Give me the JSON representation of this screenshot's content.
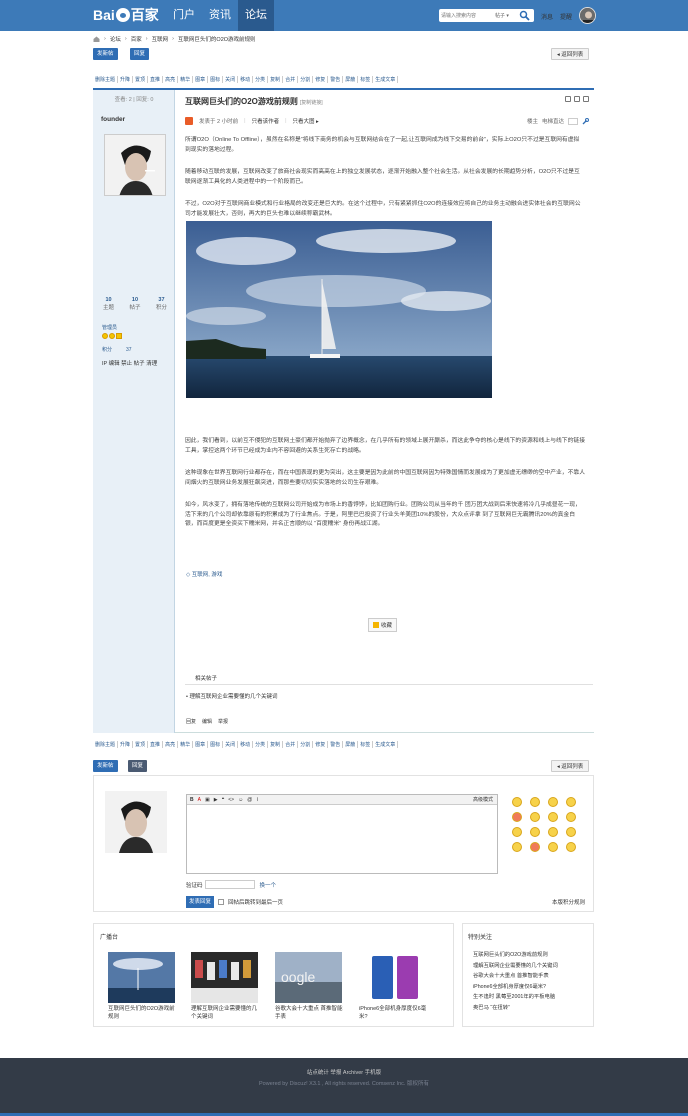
{
  "header": {
    "logo_text_left": "Bai",
    "logo_text_right": "百家",
    "nav": [
      "门户",
      "资讯",
      "论坛"
    ],
    "active_nav": "论坛",
    "search_placeholder": "请输入搜索内容",
    "search_scope": "帖子",
    "links": [
      "消息",
      "提醒"
    ]
  },
  "breadcrumb": [
    "论坛",
    "百家",
    "互联网",
    "互联网巨头们的O2O游戏前规则"
  ],
  "toolbar": {
    "new_thread": "发新帖",
    "reply": "回复",
    "back": "返回列表"
  },
  "mod_actions": [
    "删除主题",
    "升降",
    "置顶",
    "直推",
    "高亮",
    "精华",
    "图章",
    "图标",
    "关闭",
    "移动",
    "分类",
    "复制",
    "合并",
    "分割",
    "修复",
    "警告",
    "屏蔽",
    "标签",
    "生成文章"
  ],
  "post": {
    "views_label": "查看:",
    "views": "2",
    "replies_label": "回复:",
    "replies": "0",
    "title": "互联网巨头们的O2O游戏前规则",
    "copy_link": "[复制链接]",
    "author": "founder",
    "posted": "发表于 2 小时前",
    "only_author": "只看该作者",
    "view_large": "只看大图",
    "top_label": "楼主",
    "e_label": "电梯直达",
    "paragraphs": [
      "所谓O2O（Online To Offline），虽然在名称是“将线下商务的机会与互联网结合在了一起,让互联网成为线下交易的前台”，实际上O2O只不过是互联网有虚拟到现实的落地过程。",
      "随着移动互联的发展，互联网改变了旅商社会现实而高高在上的独立发展状态，逐渐开始融入整个社会生活。从社会发展的长期趋势分析，O2O只不过是互联网逐渐工具化的人类进程中的一个阶段而已。",
      "不过，O2O对于互联网商业模式和行业格局的改变还是巨大的。在这个过程中，只有紧紧抓住O2O的连接效应将自己的业务主动融合进实体社会的互联网公司才能发展壮大，否则，再大的巨头也难以继续称霸武林。"
    ],
    "paragraphs2": [
      "因此，我们看到，以前互不侵犯的互联网土豪们都开始抛弃了边界概念，在几乎所有的领域上展开厮杀，而这此争夺的核心是线下的资源和线上与线下的链接工具，掌控这两个环节已经成为业内不容回避的关系生死存亡的战略。",
      "这种现象在世界互联网行业都存在，而在中国表现的更为突出，这主要是因为此前的中国互联网因为特殊国情而发展成为了更加虚无缥缈的空中产业，不靠人间烟火的互联网业务发展狂飙突进，而那些要切切实实落地的公司生存艰难。",
      "如今，风水变了，拥有落地传统的互联网公司开始成为市场上的香饽饽，比如团购行业。团购公司从当年的千 团万团大战到后来快速将冷几乎成昼花一现，活下来的几个公司却依靠原有的积累成为了行业焦点。于是，阿里巴巴投资了行业头羊美团10%的股份，大众点评拿 到了互联网巨无霸腾讯20%的真金白银，而百度更是全资买下糯米网，并名正言顺的以 “百度糯米” 身份再战江湖。"
    ],
    "tags": "互联网, 游戏",
    "favorite": "收藏",
    "related_title": "相关帖子",
    "related_item": "• 理解互联网企业需要懂的几个关键词",
    "bottom_ops": [
      "回复",
      "编辑",
      "举报"
    ]
  },
  "user": {
    "group": "管理员",
    "points_label": "积分",
    "points": "37",
    "ops": "IP 编辑 禁止 帖子 清理",
    "counts": [
      {
        "n": "10",
        "l": "主题"
      },
      {
        "n": "10",
        "l": "帖子"
      },
      {
        "n": "37",
        "l": "积分"
      }
    ]
  },
  "reply": {
    "advanced": "高级模式",
    "captcha_label": "验证码",
    "captcha_change": "换一个",
    "submit": "发表回复",
    "return_check": "回帖后跳转到最后一页",
    "point_rule": "本版积分规则"
  },
  "broadcast": {
    "title": "广播台",
    "items": [
      "互联网巨头们的O2O游戏前规则",
      "理解互联网企业需要懂的几个关键词",
      "谷歌大会十大重点 首推智能手表",
      "iPhone6全部机身厚度仅6毫米?"
    ]
  },
  "focus": {
    "title": "特别关注",
    "items": [
      "互联网巨头们的O2O游戏前规则",
      "理解互联网企业需要懂的几个关键词",
      "谷歌大会十大重点 首推智能手表",
      "iPhone6全部机身厚度仅6毫米?",
      "生不逢时 黑莓至2001年的平板电脑",
      "奥巴马 “在扭转”"
    ]
  },
  "footer": {
    "links": "站点统计  举报  Archiver  手机版",
    "powered": "Powered by  Discuz! X3.1 , All rights reserved. Comsenz Inc.  版权所有"
  }
}
